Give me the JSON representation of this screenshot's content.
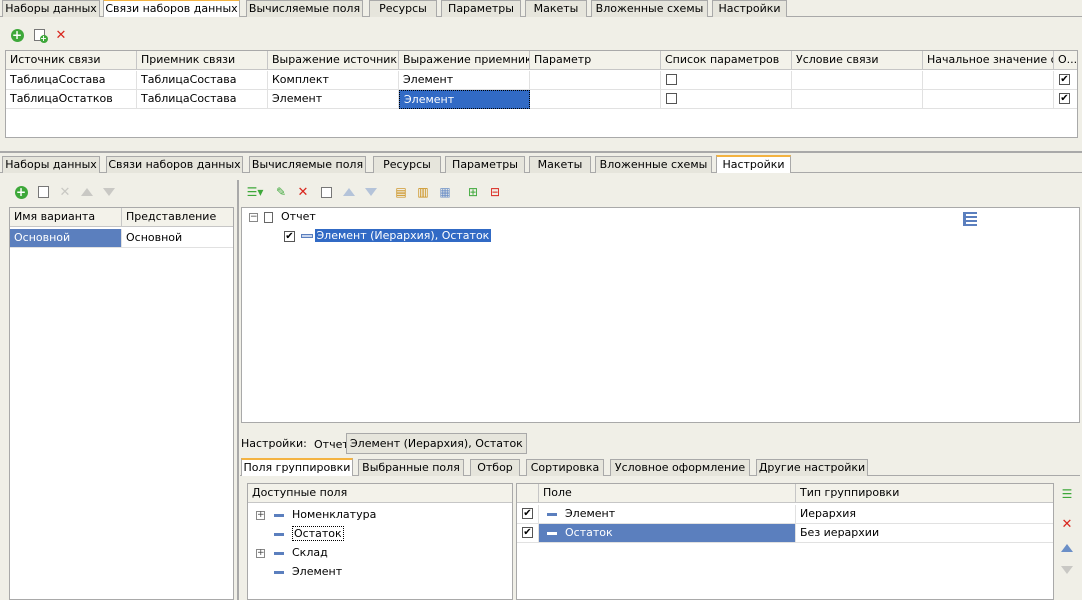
{
  "top_tabs": [
    "Наборы данных",
    "Связи наборов данных",
    "Вычисляемые поля",
    "Ресурсы",
    "Параметры",
    "Макеты",
    "Вложенные схемы",
    "Настройки"
  ],
  "top_toolbar": {
    "add": "add-icon",
    "copy": "copy-icon",
    "delete": "delete-icon"
  },
  "links_table": {
    "headers": [
      "Источник связи",
      "Приемник связи",
      "Выражение источник",
      "Выражение приемник",
      "Параметр",
      "Список параметров",
      "Условие связи",
      "Начальное значение с...",
      "О..."
    ],
    "rows": [
      {
        "source": "ТаблицаСостава",
        "target": "ТаблицаСостава",
        "source_expr": "Комплект",
        "target_expr": "Элемент",
        "param": "",
        "param_list": false,
        "condition": "",
        "initial": "",
        "opt": true
      },
      {
        "source": "ТаблицаОстатков",
        "target": "ТаблицаСостава",
        "source_expr": "Элемент",
        "target_expr": "Элемент",
        "param": "",
        "param_list": false,
        "condition": "",
        "initial": "",
        "opt": true
      }
    ]
  },
  "bottom_tabs": [
    "Наборы данных",
    "Связи наборов данных",
    "Вычисляемые поля",
    "Ресурсы",
    "Параметры",
    "Макеты",
    "Вложенные схемы",
    "Настройки"
  ],
  "variants": {
    "headers": [
      "Имя варианта",
      "Представление"
    ],
    "rows": [
      {
        "name": "Основной",
        "view": "Основной"
      }
    ]
  },
  "structure": {
    "root": "Отчет",
    "child": "Элемент (Иерархия), Остаток"
  },
  "settings_path": {
    "label": "Настройки:",
    "root": "Отчет",
    "current": "Элемент (Иерархия), Остаток"
  },
  "settings_tabs": [
    "Поля группировки",
    "Выбранные поля",
    "Отбор",
    "Сортировка",
    "Условное оформление",
    "Другие настройки"
  ],
  "available_fields": {
    "header": "Доступные поля",
    "items": [
      {
        "name": "Номенклатура",
        "expandable": true
      },
      {
        "name": "Остаток",
        "expandable": false
      },
      {
        "name": "Склад",
        "expandable": true
      },
      {
        "name": "Элемент",
        "expandable": false
      }
    ]
  },
  "group_fields": {
    "headers": [
      "Поле",
      "Тип группировки"
    ],
    "rows": [
      {
        "field": "Элемент",
        "type": "Иерархия",
        "checked": true
      },
      {
        "field": "Остаток",
        "type": "Без иерархии",
        "checked": true
      }
    ]
  }
}
